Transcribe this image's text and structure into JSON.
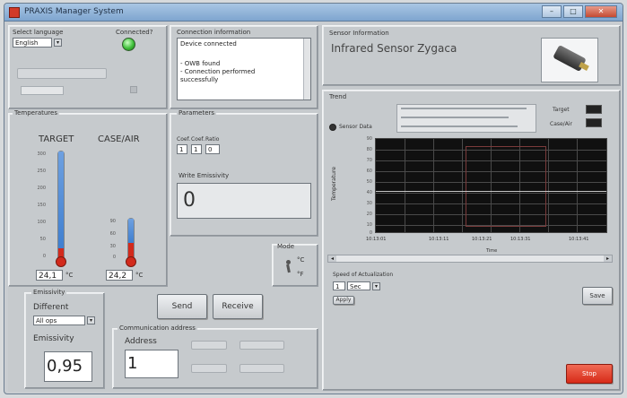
{
  "window": {
    "title": "PRAXIS Manager System"
  },
  "language": {
    "label": "Select language",
    "value": "English"
  },
  "connected": {
    "label": "Connected?",
    "led": "#3fbf3a"
  },
  "dim_left": {
    "label1": "",
    "label2": "",
    "value": ""
  },
  "connection_info": {
    "label": "Connection information",
    "lines": [
      "Device connected",
      "",
      "- OWB found",
      "- Connection performed",
      "successfully"
    ]
  },
  "temperatures": {
    "label": "Temperatures",
    "target": {
      "title": "TARGET",
      "value": "24,1",
      "unit": "°C",
      "ticks": [
        "300",
        "250",
        "200",
        "150",
        "100",
        "50",
        "0"
      ]
    },
    "case": {
      "title": "CASE/AIR",
      "value": "24,2",
      "unit": "°C",
      "ticks": [
        "90",
        "60",
        "30",
        "0"
      ]
    }
  },
  "parameters": {
    "label": "Parameters",
    "col_labels": [
      "Coef.",
      "Coef.",
      "Ratio"
    ],
    "values": [
      "1",
      "1",
      "0"
    ],
    "readout_label": "Write Emissivity",
    "readout_value": "0"
  },
  "mode": {
    "label": "Mode",
    "options": [
      "°C",
      "°F"
    ]
  },
  "sensor": {
    "label": "Sensor Information",
    "name": "Infrared Sensor Zygaca"
  },
  "trend": {
    "label": "Trend",
    "radio_label": "Sensor Data",
    "legend_lines": [
      "",
      "",
      ""
    ],
    "legend_target": "Target",
    "legend_case": "Case/Air",
    "y_label": "Temperature",
    "x_label": "Time",
    "y_ticks": [
      "90",
      "80",
      "70",
      "60",
      "50",
      "40",
      "30",
      "20",
      "10",
      "0"
    ],
    "x_ticks": [
      "10:13:01",
      "10:13:11",
      "10:13:21",
      "10:13:31",
      "10:13:41"
    ]
  },
  "update_interval": {
    "label": "Speed of Actualization",
    "value": "1",
    "unit": "Sec",
    "apply_label": "Apply"
  },
  "emissivity": {
    "label": "Emissivity",
    "setting_label": "Different",
    "dropdown_value": "All ops",
    "field_label": "Emissivity",
    "value": "0,95"
  },
  "buttons": {
    "send": "Send",
    "receive": "Receive",
    "save": "Save",
    "stop": "Stop"
  },
  "comm": {
    "label": "Communication address",
    "field_label": "Address",
    "value": "1",
    "dim_labels": [
      "",
      "",
      "",
      ""
    ]
  },
  "colors": {
    "plot_bg": "#101010",
    "grid": "#4a4a4a",
    "accent_red": "#e0301e",
    "fill_blue": "#3f7fd0",
    "bulb_red": "#d22a1c"
  },
  "icons": {
    "app": "app-icon",
    "sensor": "sensor-image-icon",
    "mode": "person-icon"
  }
}
